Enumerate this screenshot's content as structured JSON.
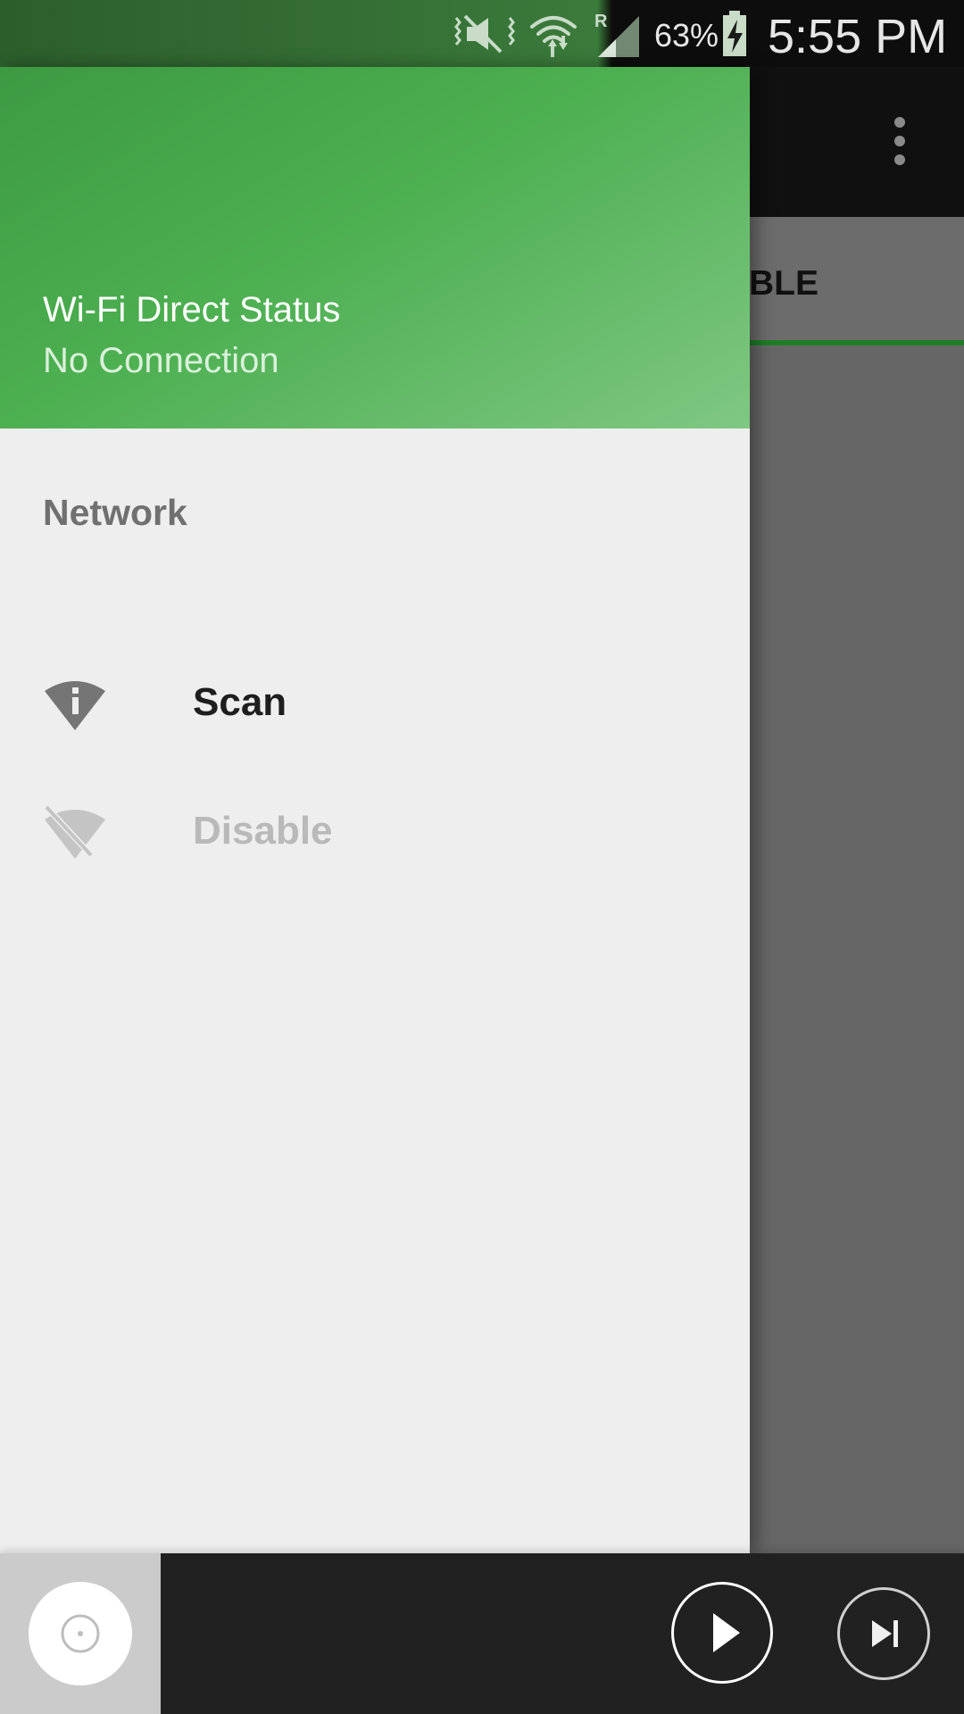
{
  "status_bar": {
    "battery_percent": "63%",
    "time": "5:55 PM",
    "icons": [
      "vibrate-mute-icon",
      "wifi-data-icon",
      "roaming-signal-icon",
      "battery-charging-icon"
    ]
  },
  "app": {
    "tab_label": "ABLE",
    "menu_icon": "more-vert-icon"
  },
  "drawer": {
    "header": {
      "title": "Wi-Fi Direct Status",
      "subtitle": "No Connection"
    },
    "section_label": "Network",
    "items": [
      {
        "label": "Scan",
        "icon": "wifi-info-icon",
        "enabled": true
      },
      {
        "label": "Disable",
        "icon": "wifi-off-icon",
        "enabled": false
      }
    ]
  },
  "media_bar": {
    "album_icon": "disc-icon",
    "play_icon": "play-icon",
    "next_icon": "skip-next-icon"
  },
  "colors": {
    "drawer_header_green": "#4caf50",
    "status_bar_green": "#2e6b2e",
    "tab_indicator": "#1f7d26",
    "drawer_bg": "#eeeeee",
    "media_bar_bg": "#212121"
  }
}
